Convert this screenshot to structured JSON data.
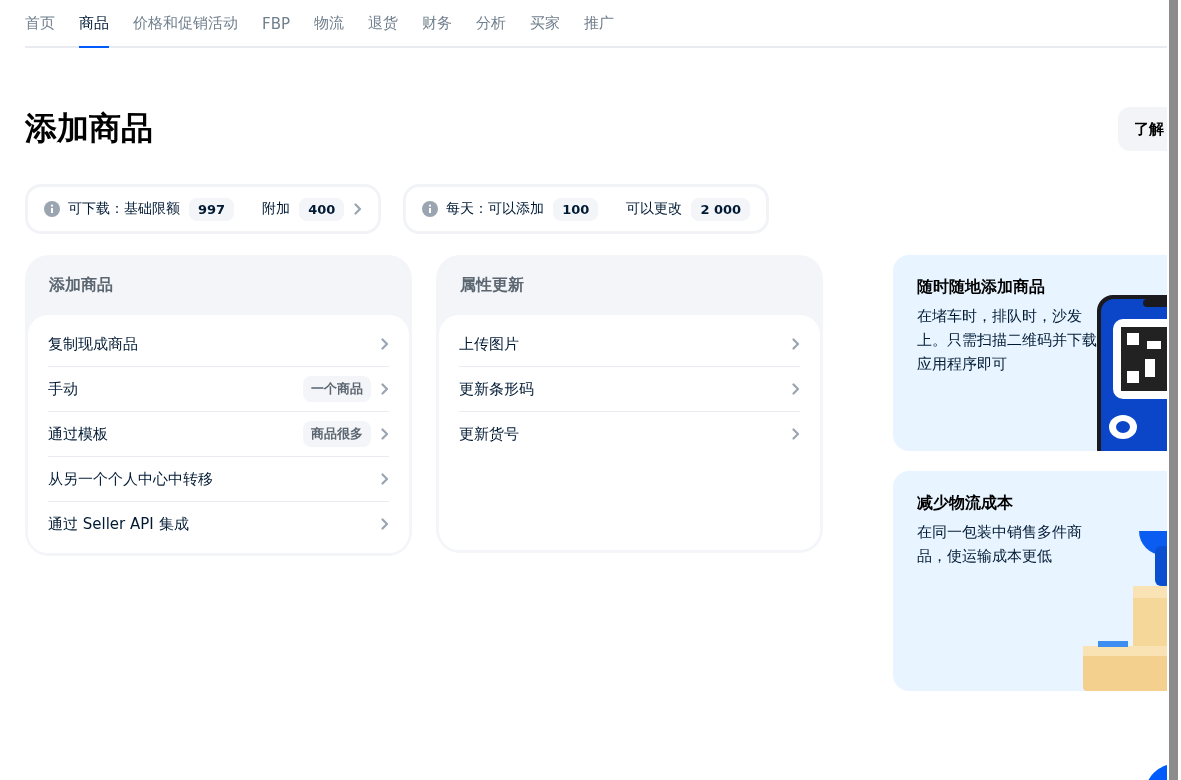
{
  "tabs": [
    {
      "label": "首页",
      "selected": false
    },
    {
      "label": "商品",
      "selected": true
    },
    {
      "label": "价格和促销活动",
      "selected": false
    },
    {
      "label": "FBP",
      "selected": false
    },
    {
      "label": "物流",
      "selected": false
    },
    {
      "label": "退货",
      "selected": false
    },
    {
      "label": "财务",
      "selected": false
    },
    {
      "label": "分析",
      "selected": false
    },
    {
      "label": "买家",
      "selected": false
    },
    {
      "label": "推广",
      "selected": false
    }
  ],
  "title": "添加商品",
  "learn_button": "了解",
  "limits": [
    {
      "label": "可下载：基础限额",
      "value": "997",
      "extra_label": "附加",
      "extra_value": "400",
      "has_arrow": true
    },
    {
      "label": "每天：可以添加",
      "value": "100",
      "extra_label": "可以更改",
      "extra_value": "2 000",
      "has_arrow": false
    }
  ],
  "panels": [
    {
      "title": "添加商品",
      "items": [
        {
          "label": "复制现成商品"
        },
        {
          "label": "手动",
          "badge": "一个商品"
        },
        {
          "label": "通过模板",
          "badge": "商品很多"
        },
        {
          "label": "从另一个个人中心中转移"
        },
        {
          "label": "通过 Seller API 集成"
        }
      ]
    },
    {
      "title": "属性更新",
      "items": [
        {
          "label": "上传图片"
        },
        {
          "label": "更新条形码"
        },
        {
          "label": "更新货号"
        }
      ]
    }
  ],
  "promos": [
    {
      "title": "随时随地添加商品",
      "text": "在堵车时，排队时，沙发上。只需扫描二维码并下载应用程序即可"
    },
    {
      "title": "减少物流成本",
      "text": "在同一包装中销售多件商品，使运输成本更低"
    }
  ]
}
